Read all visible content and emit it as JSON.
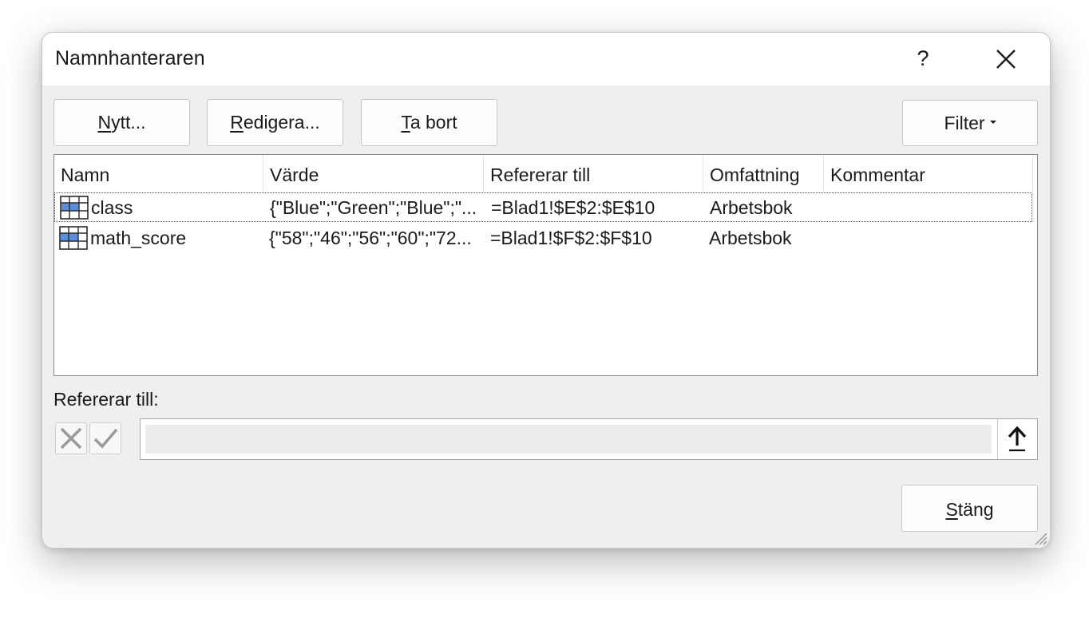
{
  "dialog": {
    "title": "Namnhanteraren",
    "help_label": "?"
  },
  "toolbar": {
    "new": {
      "mnemonic": "N",
      "rest": "ytt..."
    },
    "edit": {
      "mnemonic": "R",
      "rest": "edigera..."
    },
    "delete": {
      "mnemonic": "T",
      "rest": "a bort"
    },
    "filter_label": "Filter"
  },
  "table": {
    "columns": [
      "Namn",
      "Värde",
      "Refererar till",
      "Omfattning",
      "Kommentar"
    ],
    "rows": [
      {
        "name": "class",
        "value": "{\"Blue\";\"Green\";\"Blue\";\"...",
        "refers_to": "=Blad1!$E$2:$E$10",
        "scope": "Arbetsbok",
        "comment": "",
        "icon": "named-range-icon"
      },
      {
        "name": "math_score",
        "value": "{\"58\";\"46\";\"56\";\"60\";\"72...",
        "refers_to": "=Blad1!$F$2:$F$10",
        "scope": "Arbetsbok",
        "comment": "",
        "icon": "named-range-icon"
      }
    ]
  },
  "refers_to_section": {
    "label": "Refererar till:",
    "value": "",
    "placeholder": ""
  },
  "footer": {
    "close": {
      "mnemonic": "S",
      "rest": "täng"
    }
  },
  "colors": {
    "dialog_bg": "#efefef",
    "titlebar_bg": "#ffffff",
    "icon_blue": "#5b8ed8"
  }
}
